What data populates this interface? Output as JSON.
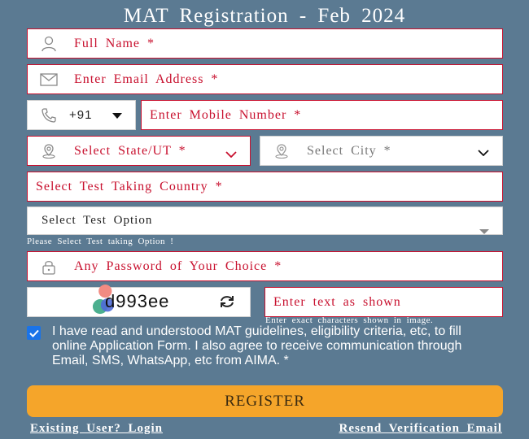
{
  "title": "MAT Registration - Feb 2024",
  "form": {
    "full_name_placeholder": "Full Name *",
    "email_placeholder": "Enter Email Address *",
    "country_code": "+91",
    "mobile_placeholder": "Enter Mobile Number *",
    "state_placeholder": "Select State/UT *",
    "city_placeholder": "Select City *",
    "test_country_placeholder": "Select Test Taking Country *",
    "test_option_label": "Select Test Option",
    "test_option_hint": "Please Select Test taking Option !",
    "password_placeholder": "Any Password of Your Choice *",
    "captcha_text": "d993ee",
    "captcha_input_placeholder": "Enter text as shown",
    "captcha_hint": "Enter exact characters shown in image.",
    "consent_text": "I have read and understood MAT guidelines, eligibility criteria, etc, to fill online Application Form. I also agree to receive communication through Email, SMS, WhatsApp, etc from AIMA. *",
    "consent_checked": true,
    "register_label": "REGISTER"
  },
  "links": {
    "existing_user": "Existing User? Login",
    "resend": "Resend Verification Email"
  },
  "colors": {
    "background": "#5b7a92",
    "required_border": "#c8102e",
    "register_button": "#f5a52a",
    "checkbox": "#1a73e8"
  },
  "icons": [
    "user-icon",
    "mail-icon",
    "phone-icon",
    "location-icon",
    "lock-icon",
    "refresh-icon",
    "chevron-down-icon"
  ]
}
